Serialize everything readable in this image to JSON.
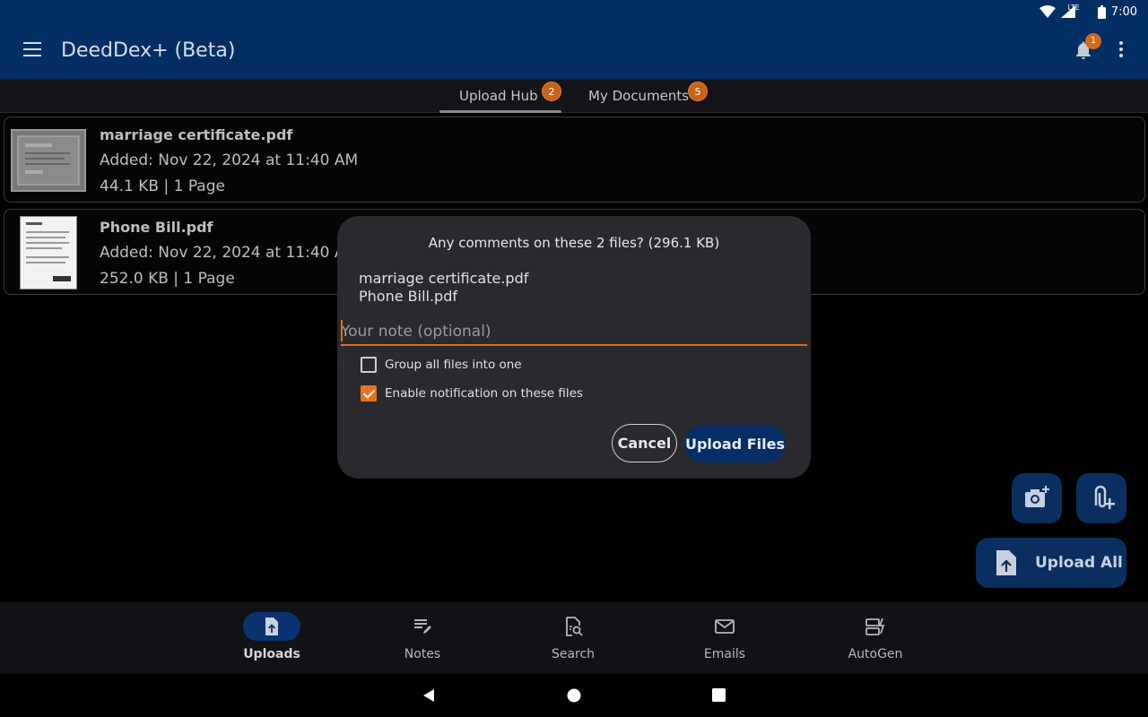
{
  "status": {
    "network": "LTE",
    "time": "7:00"
  },
  "appbar": {
    "title": "DeedDex+ (Beta)",
    "notification_count": "1"
  },
  "tabs": [
    {
      "label": "Upload Hub",
      "badge": "2"
    },
    {
      "label": "My Documents",
      "badge": "5"
    }
  ],
  "files": [
    {
      "name": "marriage certificate.pdf",
      "added": "Added: Nov 22, 2024 at 11:40 AM",
      "meta": "44.1 KB | 1 Page"
    },
    {
      "name": "Phone Bill.pdf",
      "added": "Added: Nov 22, 2024 at 11:40 AM",
      "meta": "252.0 KB | 1 Page"
    }
  ],
  "dialog": {
    "title": "Any comments on these 2 files? (296.1 KB)",
    "file_list": [
      "marriage certificate.pdf",
      "Phone Bill.pdf"
    ],
    "note_placeholder": "Your note (optional)",
    "options": [
      {
        "label": "Group all files into one",
        "checked": false
      },
      {
        "label": "Enable notification on these files",
        "checked": true
      }
    ],
    "cancel_label": "Cancel",
    "upload_label": "Upload Files"
  },
  "fab": {
    "upload_all_label": "Upload All"
  },
  "bottom_nav": [
    {
      "label": "Uploads",
      "icon": "upload-file-icon",
      "active": true
    },
    {
      "label": "Notes",
      "icon": "notes-icon",
      "active": false
    },
    {
      "label": "Search",
      "icon": "document-search-icon",
      "active": false
    },
    {
      "label": "Emails",
      "icon": "mail-icon",
      "active": false
    },
    {
      "label": "AutoGen",
      "icon": "autogen-icon",
      "active": false
    }
  ],
  "colors": {
    "appbar": "#022e63",
    "accent": "#e8711f",
    "primary_button": "#052d66"
  }
}
